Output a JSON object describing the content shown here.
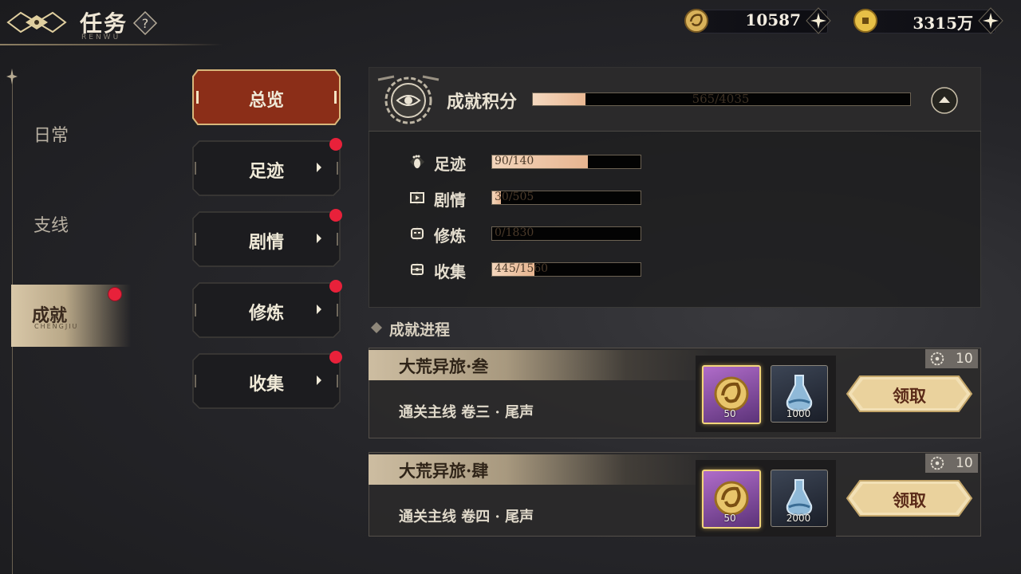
{
  "header": {
    "title": "任务",
    "subtitle": "RENWU",
    "help_icon": "question-icon"
  },
  "currency": [
    {
      "icon": "dragon-coin-icon",
      "value": "10587"
    },
    {
      "icon": "copper-coin-icon",
      "value": "3315万"
    }
  ],
  "sidebar": {
    "items": [
      {
        "label": "日常"
      },
      {
        "label": "支线"
      },
      {
        "label": "成就",
        "sub": "CHENGJIU",
        "active": true
      }
    ]
  },
  "tabs": [
    {
      "label": "总览",
      "active": true
    },
    {
      "label": "足迹",
      "badge": true
    },
    {
      "label": "剧情",
      "badge": true
    },
    {
      "label": "修炼",
      "badge": true
    },
    {
      "label": "收集",
      "badge": true
    }
  ],
  "score": {
    "label": "成就积分",
    "text": "565/4035",
    "value": 565,
    "max": 4035
  },
  "categories": [
    {
      "name": "足迹",
      "text": "90/140",
      "value": 90,
      "max": 140,
      "icon": "footprint-icon"
    },
    {
      "name": "剧情",
      "text": "30/505",
      "value": 30,
      "max": 505,
      "icon": "film-icon"
    },
    {
      "name": "修炼",
      "text": "0/1830",
      "value": 0,
      "max": 1830,
      "icon": "mask-icon"
    },
    {
      "name": "收集",
      "text": "445/1560",
      "value": 445,
      "max": 1560,
      "icon": "collection-icon"
    }
  ],
  "progress": {
    "title": "成就进程",
    "items": [
      {
        "name": "大荒异旅·叁",
        "desc": "通关主线 卷三 · 尾声",
        "points": "10",
        "rewards": [
          {
            "qty": "50",
            "icon": "dragon-coin-icon"
          },
          {
            "qty": "1000",
            "icon": "potion-icon"
          }
        ],
        "claim": "领取"
      },
      {
        "name": "大荒异旅·肆",
        "desc": "通关主线 卷四 · 尾声",
        "points": "10",
        "rewards": [
          {
            "qty": "50",
            "icon": "dragon-coin-icon"
          },
          {
            "qty": "2000",
            "icon": "potion-icon"
          }
        ],
        "claim": "领取"
      }
    ]
  },
  "colors": {
    "accent_active_tab": "#8b2e18",
    "badge_red": "#e8213a",
    "bar_fill": "#eab893"
  }
}
